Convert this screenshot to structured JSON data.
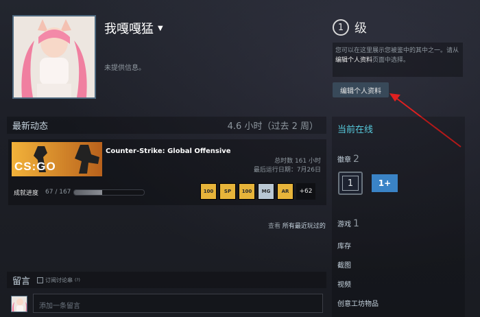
{
  "profile": {
    "persona_name": "我嘎嘎猛",
    "no_info": "未提供信息。",
    "level_label": "级",
    "level_value": "1",
    "showcase_hint_pre": "您可以在这里展示您被鉴中的其中之一。请从",
    "showcase_hint_link": "编辑个人资料",
    "showcase_hint_post": "页面中选择。",
    "edit_button": "编辑个人资料"
  },
  "activity": {
    "title": "最新动态",
    "hours_summary": "4.6 小时（过去 2 周）",
    "game": {
      "name": "Counter-Strike: Global Offensive",
      "logo_text": "CS:GO",
      "total_hours": "总时数 161 小时",
      "last_played": "最后运行日期：7月26日",
      "achievement_label": "成就进度",
      "achievement_count": "67 / 167",
      "achievement_progress": 0.4,
      "achievement_more": "+62",
      "achievement_icons": [
        "100",
        "SP",
        "100",
        "MG",
        "AR"
      ]
    },
    "view_all_prefix": "查看",
    "view_all_link": "所有最近玩过的"
  },
  "comments": {
    "title": "留言",
    "subscribe_label": "订阅讨论串",
    "subscribe_help": "(?)",
    "placeholder": "添加一条留言"
  },
  "sidebar": {
    "status": "当前在线",
    "badges_label": "徽章",
    "badges_count": "2",
    "badge1_value": "1",
    "badge2_value": "1+",
    "games_label": "游戏",
    "games_count": "1",
    "links": [
      "库存",
      "截图",
      "视频",
      "创意工坊物品"
    ]
  },
  "colors": {
    "accent_online": "#57cbde",
    "button_bg": "#384959",
    "arrow_red": "#e02020",
    "achievement_gold": "#e7b43a"
  }
}
